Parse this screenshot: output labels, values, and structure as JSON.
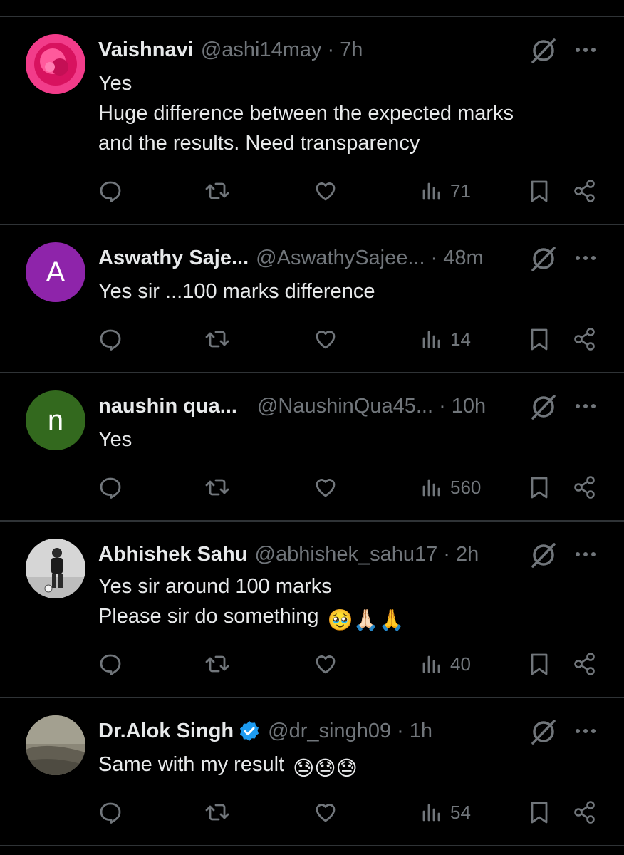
{
  "tweets": [
    {
      "name": "Vaishnavi",
      "handle": "@ashi14may",
      "time": "7h",
      "verified": false,
      "avatar": {
        "type": "image",
        "color": "#e0196f"
      },
      "lines": [
        "Yes",
        "Huge difference between the expected marks",
        "and the results. Need transparency"
      ],
      "emoji": "",
      "views": "71"
    },
    {
      "name": "Aswathy Saje...",
      "handle": "@AswathySajee...",
      "time": "48m",
      "verified": false,
      "avatar": {
        "type": "letter",
        "letter": "A",
        "color": "#8e24aa"
      },
      "lines": [
        "Yes sir ...100 marks difference"
      ],
      "emoji": "",
      "views": "14"
    },
    {
      "name": "naushin qua...",
      "handle": "@NaushinQua45...",
      "time": "10h",
      "verified": false,
      "avatar": {
        "type": "letter",
        "letter": "n",
        "color": "#33691e"
      },
      "lines": [
        "Yes"
      ],
      "emoji": "",
      "views": "560"
    },
    {
      "name": "Abhishek Sahu",
      "handle": "@abhishek_sahu17",
      "time": "2h",
      "verified": false,
      "avatar": {
        "type": "image",
        "color": "#cfcfcf"
      },
      "lines": [
        "Yes sir around 100 marks",
        "Please sir do something"
      ],
      "emoji": "🥹🙏🏻🙏",
      "views": "40"
    },
    {
      "name": "Dr.Alok Singh",
      "handle": "@dr_singh09",
      "time": "1h",
      "verified": true,
      "avatar": {
        "type": "image",
        "color": "#7a7668"
      },
      "lines": [
        "Same with my result"
      ],
      "emoji": "😓😓😓",
      "views": "54"
    }
  ],
  "colors": {
    "background": "#000000",
    "text": "#e7e9ea",
    "secondary": "#71767b",
    "divider": "#2f3336",
    "verified": "#1d9bf0"
  },
  "icons": {
    "reply": "reply-icon",
    "retweet": "retweet-icon",
    "like": "like-icon",
    "views": "views-icon",
    "bookmark": "bookmark-icon",
    "share": "share-icon",
    "grok": "grok-icon",
    "more": "more-icon"
  }
}
